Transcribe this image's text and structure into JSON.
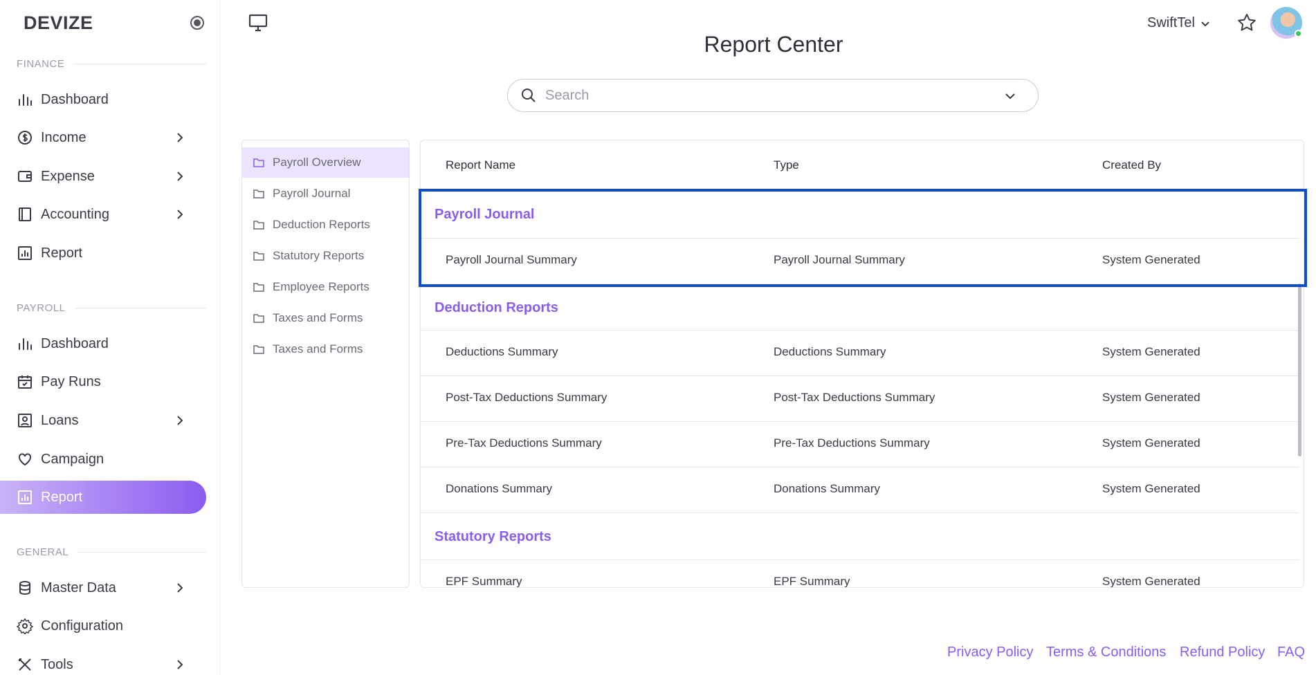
{
  "brand": "DEVIZE",
  "sidebar": {
    "sections": [
      {
        "label": "FINANCE"
      },
      {
        "label": "PAYROLL"
      },
      {
        "label": "GENERAL"
      }
    ],
    "finance": [
      "Dashboard",
      "Income",
      "Expense",
      "Accounting",
      "Report"
    ],
    "payroll": [
      "Dashboard",
      "Pay Runs",
      "Loans",
      "Campaign",
      "Report"
    ],
    "general": [
      "Master Data",
      "Configuration",
      "Tools"
    ]
  },
  "header": {
    "title": "Report Center",
    "org": "SwiftTel"
  },
  "search": {
    "placeholder": "Search"
  },
  "folders": [
    "Payroll Overview",
    "Payroll Journal",
    "Deduction Reports",
    "Statutory Reports",
    "Employee Reports",
    "Taxes and Forms",
    "Taxes and Forms"
  ],
  "table": {
    "columns": [
      "Report Name",
      "Type",
      "Created By"
    ],
    "groups": [
      {
        "name": "Payroll Journal",
        "rows": [
          [
            "Payroll Journal Summary",
            "Payroll Journal Summary",
            "System Generated"
          ]
        ]
      },
      {
        "name": "Deduction Reports",
        "rows": [
          [
            "Deductions Summary",
            "Deductions Summary",
            "System Generated"
          ],
          [
            "Post-Tax Deductions Summary",
            "Post-Tax Deductions Summary",
            "System Generated"
          ],
          [
            "Pre-Tax Deductions Summary",
            "Pre-Tax Deductions Summary",
            "System Generated"
          ],
          [
            "Donations Summary",
            "Donations Summary",
            "System Generated"
          ]
        ]
      },
      {
        "name": "Statutory Reports",
        "rows": [
          [
            "EPF Summary",
            "EPF Summary",
            "System Generated"
          ]
        ]
      }
    ]
  },
  "footer": [
    "Privacy Policy",
    "Terms & Conditions",
    "Refund Policy",
    "FAQ"
  ],
  "colors": {
    "accent": "#8a5cf0",
    "highlight": "#0a4fd0"
  }
}
